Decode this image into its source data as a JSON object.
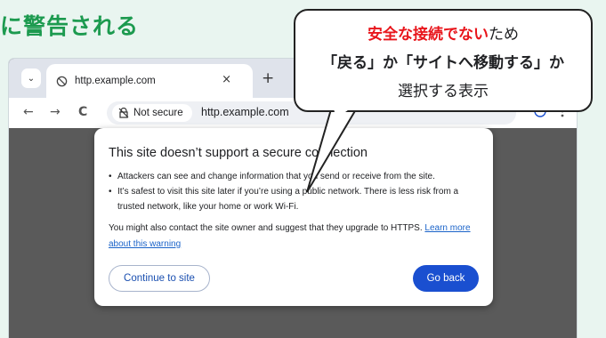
{
  "headline": "に警告される",
  "browser": {
    "tab_title": "http.example.com",
    "tab_close": "×",
    "new_tab": "+",
    "menu_chevron": "⌄",
    "nav": {
      "back": "←",
      "forward": "→",
      "reload": "C"
    },
    "chip_label": "Not secure",
    "url": "http.example.com",
    "icons": [
      "globe-icon",
      "not-secure-icon",
      "star-icon",
      "profile-icon",
      "more-icon"
    ]
  },
  "dialog": {
    "title": "This site doesn’t support a secure connection",
    "bullets": [
      "Attackers can see and change information that you send or receive from the site.",
      "It’s safest to visit this site later if you’re using a public network. There is less risk from a trusted network, like your home or work Wi-Fi."
    ],
    "para_text": "You might also contact the site owner and suggest that they upgrade to HTTPS.",
    "para_link": "Learn more about this warning",
    "continue_label": "Continue to site",
    "back_label": "Go back"
  },
  "callout": {
    "line1_red": "安全な接続でない",
    "line1_rest": "ため",
    "line2": "「戻る」か「サイトへ移動する」か",
    "line3": "選択する表示"
  },
  "colors": {
    "headline": "#1c9a4f",
    "callout_red": "#e8151b",
    "go_back": "#1a4fd0"
  }
}
